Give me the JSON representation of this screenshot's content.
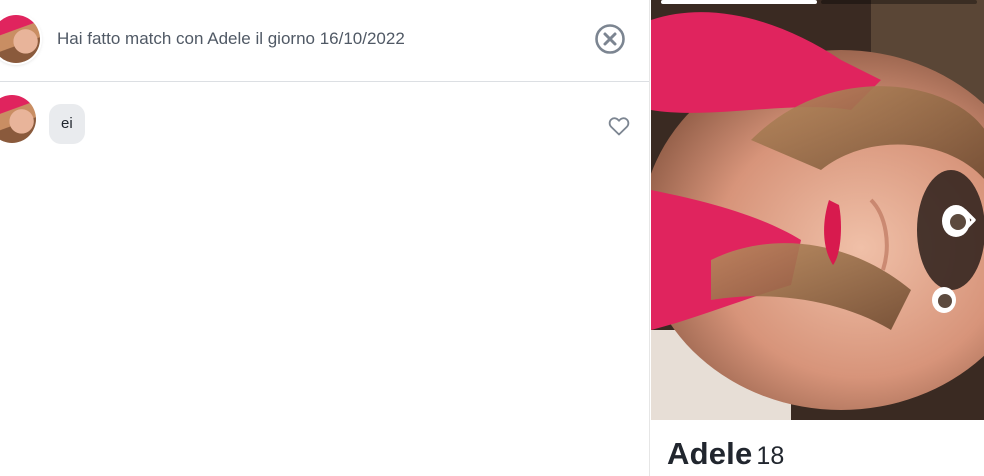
{
  "chat_header": {
    "match_text": "Hai fatto match con Adele il giorno 16/10/2022",
    "close_icon": "close-circle-icon"
  },
  "messages": [
    {
      "text": "ei",
      "sender": "Adele",
      "like_icon": "heart-outline-icon"
    }
  ],
  "profile": {
    "name": "Adele",
    "age": "18",
    "photo_count": 2,
    "current_photo": 1,
    "next_icon": "chevron-right-icon"
  },
  "colors": {
    "text_primary": "#21262e",
    "text_secondary": "#505965",
    "bubble_bg": "#e9ebee",
    "icon_gray": "#7c8591",
    "divider": "#dcdfe3"
  }
}
